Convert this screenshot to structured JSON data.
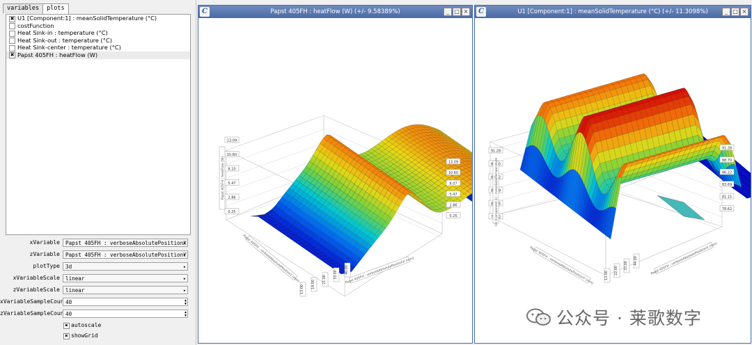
{
  "tabs": [
    {
      "label": "variables"
    },
    {
      "label": "plots"
    }
  ],
  "plot_list": [
    {
      "label": "U1 [Component:1] : meanSolidTemperature (°C)",
      "checked": true
    },
    {
      "label": "costFunction",
      "checked": false
    },
    {
      "label": "Heat Sink-in : temperature (°C)",
      "checked": false
    },
    {
      "label": "Heat Sink-out : temperature (°C)",
      "checked": false
    },
    {
      "label": "Heat Sink-center : temperature (°C)",
      "checked": false
    },
    {
      "label": "Papst 405FH : heatFlow (W)",
      "checked": true
    }
  ],
  "form": {
    "xVariable": {
      "label": "xVariable",
      "value": "Papst 405FH : verboseAbsolutePositionX (mm)"
    },
    "zVariable": {
      "label": "zVariable",
      "value": "Papst 405FH : verboseAbsolutePositionY (mm)"
    },
    "plotType": {
      "label": "plotType",
      "value": "3d"
    },
    "xVariableScale": {
      "label": "xVariableScale",
      "value": "linear"
    },
    "zVariableScale": {
      "label": "zVariableScale",
      "value": "linear"
    },
    "xVariableSampleCount": {
      "label": "xVariableSampleCount",
      "value": "40"
    },
    "zVariableSampleCount": {
      "label": "zVariableSampleCount",
      "value": "40"
    },
    "autoscale": {
      "label": "autoscale",
      "checked": true
    },
    "showGrid": {
      "label": "showGrid",
      "checked": true
    }
  },
  "windows": [
    {
      "title": "Papst 405FH : heatFlow (W) (+/- 9.58389%)",
      "app_icon": "C",
      "left_ticks": [
        "13.09",
        "10.60",
        "8.10",
        "5.47",
        "2.86",
        "0.25"
      ],
      "right_ticks": [
        "13.09",
        "10.60",
        "8.07",
        "5.47",
        "2.86",
        "0.25"
      ],
      "front_ticks": [
        "13.00",
        "14.00",
        "21.00",
        "33.00",
        "40.00"
      ],
      "vertical_axis_label": "Papst 405FH : heatFlow (W)",
      "depth_axis_label": "Papst 405FH : verboseAbsolutePositionY (mm)",
      "width_axis_label": "Papst 405FH : verboseAbsolutePositionX (mm)"
    },
    {
      "title": "U1 [Component:1] : meanSolidTemperature (°C) (+/- 11.3098%)",
      "app_icon": "C",
      "left_ticks": [
        "91.28",
        "88.70",
        "86.22",
        "83.69",
        "81.15",
        "78.62"
      ],
      "right_ticks": [
        "91.28",
        "88.70",
        "86.22",
        "83.69",
        "81.15",
        "78.62"
      ],
      "front_ticks": [
        "13.00",
        "22.00",
        "33.00",
        "44.00"
      ],
      "vertical_axis_label": "U1 [Component:1] : meanSolidTemperature",
      "depth_axis_label": "Papst 405FH : verboseAbsolutePositionY (mm)",
      "width_axis_label": "Papst 405FH : verboseAbsolutePositionX (mm)"
    }
  ],
  "watermark": {
    "text": "公众号 · 莱歌数字",
    "icon": "wechat-icon"
  },
  "colors": {
    "titlebar": "#4a6aa3",
    "surface_high": "#d70f05",
    "surface_low": "#0d47d0"
  }
}
